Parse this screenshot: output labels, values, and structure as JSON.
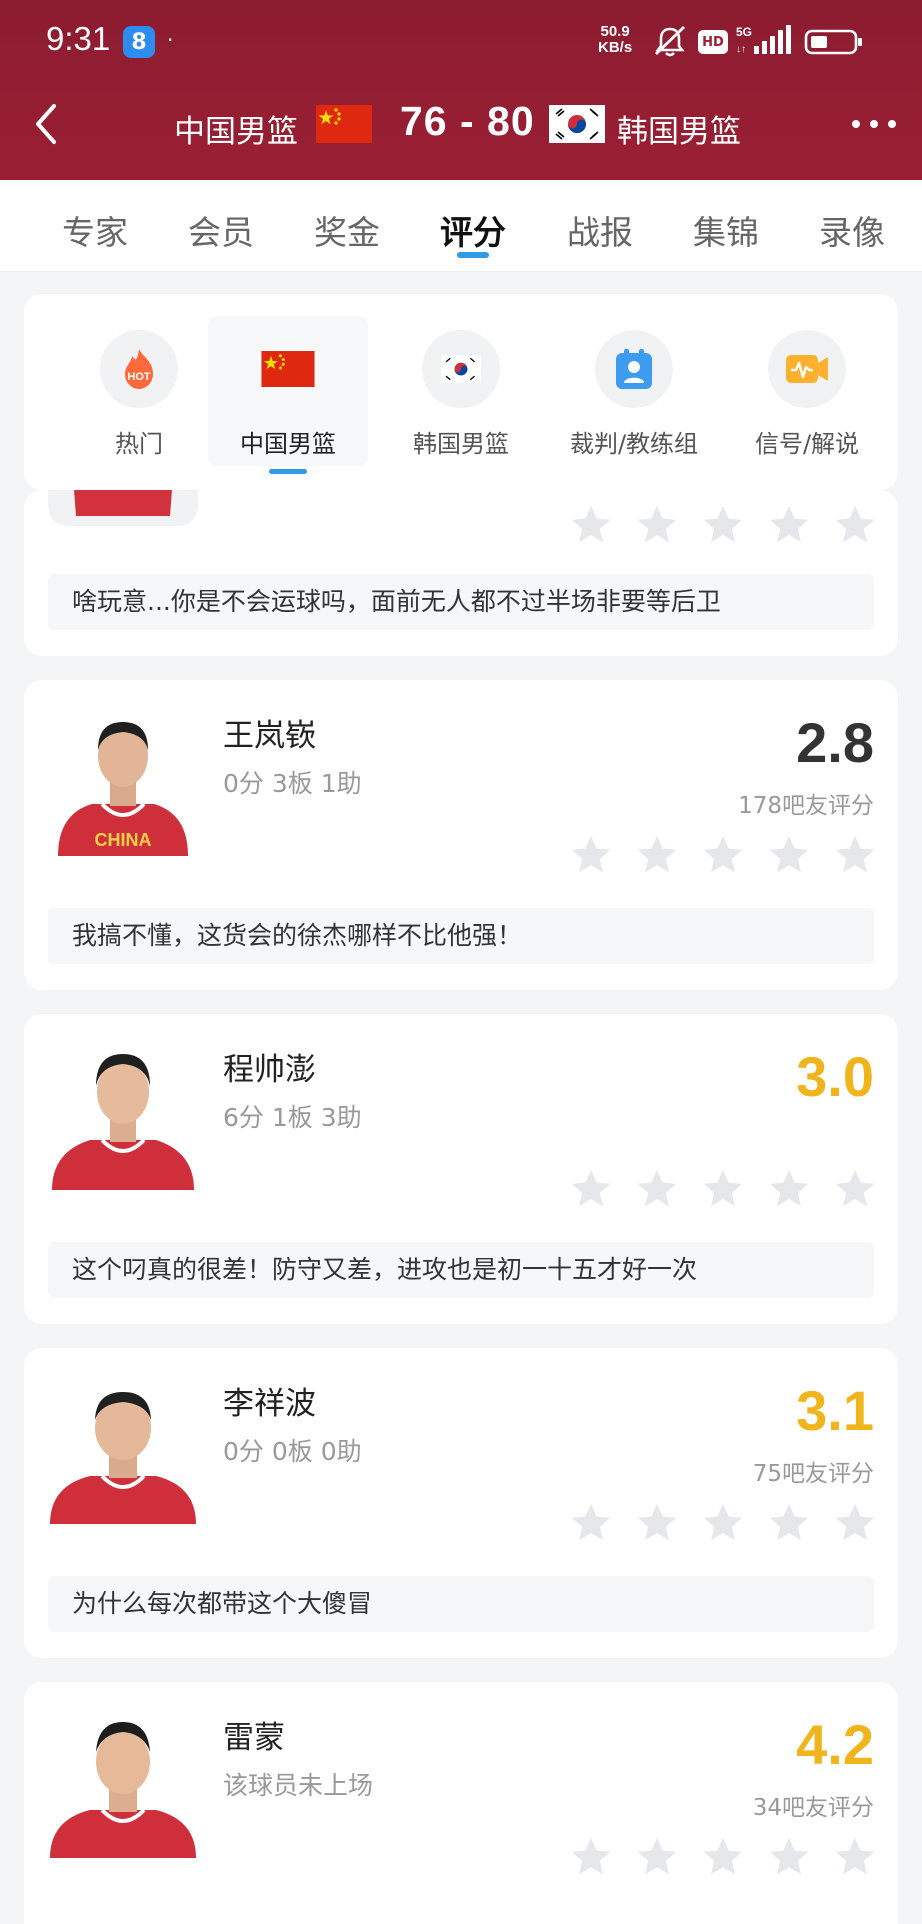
{
  "status_bar": {
    "time": "9:31",
    "app_badge": "8",
    "dot": "·",
    "speed_value": "50.9",
    "speed_unit": "KB/s",
    "hd": "HD"
  },
  "header": {
    "home_team": "中国男篮",
    "score": "76 - 80",
    "away_team": "韩国男篮"
  },
  "tabs": [
    {
      "label": "专家"
    },
    {
      "label": "会员"
    },
    {
      "label": "奖金"
    },
    {
      "label": "评分",
      "active": true
    },
    {
      "label": "战报"
    },
    {
      "label": "集锦"
    },
    {
      "label": "录像"
    }
  ],
  "categories": [
    {
      "label": "热门",
      "icon": "hot-icon",
      "badge": "HOT"
    },
    {
      "label": "中国男篮",
      "icon": "china-flag-icon",
      "active": true
    },
    {
      "label": "韩国男篮",
      "icon": "korea-flag-icon"
    },
    {
      "label": "裁判/教练组",
      "icon": "referee-icon"
    },
    {
      "label": "信号/解说",
      "icon": "signal-icon"
    }
  ],
  "partial_card": {
    "comment": "啥玩意...你是不会运球吗，面前无人都不过半场非要等后卫"
  },
  "players": [
    {
      "name": "王岚嵚",
      "stats": "0分 3板 1助",
      "rating": "2.8",
      "rating_color": "#333333",
      "count": "178吧友评分",
      "comment": "我搞不懂，这货会的徐杰哪样不比他强！"
    },
    {
      "name": "程帅澎",
      "stats": "6分 1板 3助",
      "rating": "3.0",
      "rating_color": "#f0b41c",
      "count": "",
      "comment": "这个叼真的很差！防守又差，进攻也是初一十五才好一次"
    },
    {
      "name": "李祥波",
      "stats": "0分 0板 0助",
      "rating": "3.1",
      "rating_color": "#f0b41c",
      "count": "75吧友评分",
      "comment": "为什么每次都带这个大傻冒"
    },
    {
      "name": "雷蒙",
      "stats": "该球员未上场",
      "rating": "4.2",
      "rating_color": "#f0b41c",
      "count": "34吧友评分",
      "comment": ""
    }
  ],
  "colors": {
    "header_bg": "#9a1f34",
    "accent_blue": "#2e9be6",
    "rating_gold": "#f0b41c",
    "star_gray": "#e6e7ea"
  }
}
